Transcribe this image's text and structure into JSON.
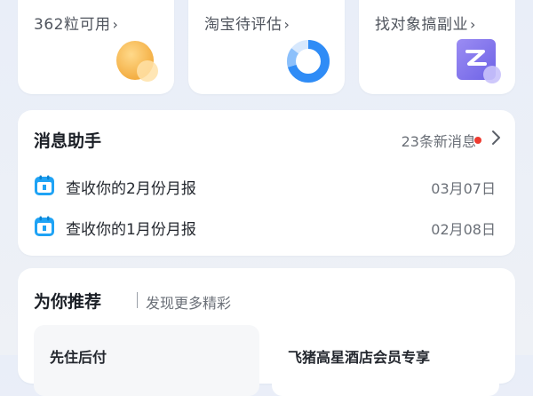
{
  "top_cards": [
    {
      "subtitle": "362粒可用",
      "chevron": "›",
      "icon": "golden-bean-icon"
    },
    {
      "subtitle": "淘宝待评估",
      "chevron": "›",
      "icon": "progress-ring-icon"
    },
    {
      "subtitle": "找对象搞副业",
      "chevron": "›",
      "icon": "z-app-icon"
    }
  ],
  "message_assistant": {
    "title": "消息助手",
    "count_text": "23条新消息",
    "items": [
      {
        "text": "查收你的2月份月报",
        "date": "03月07日",
        "icon": "calendar-icon"
      },
      {
        "text": "查收你的1月份月报",
        "date": "02月08日",
        "icon": "calendar-icon"
      }
    ]
  },
  "recommend": {
    "title": "为你推荐",
    "subtitle": "发现更多精彩",
    "tiles": [
      "先住后付",
      "飞猪高星酒店会员专享"
    ]
  },
  "colors": {
    "accent_blue": "#2f8cf6",
    "badge_red": "#ee3b30",
    "z_purple": "#6e63e6",
    "bean_orange": "#f4b54a"
  }
}
